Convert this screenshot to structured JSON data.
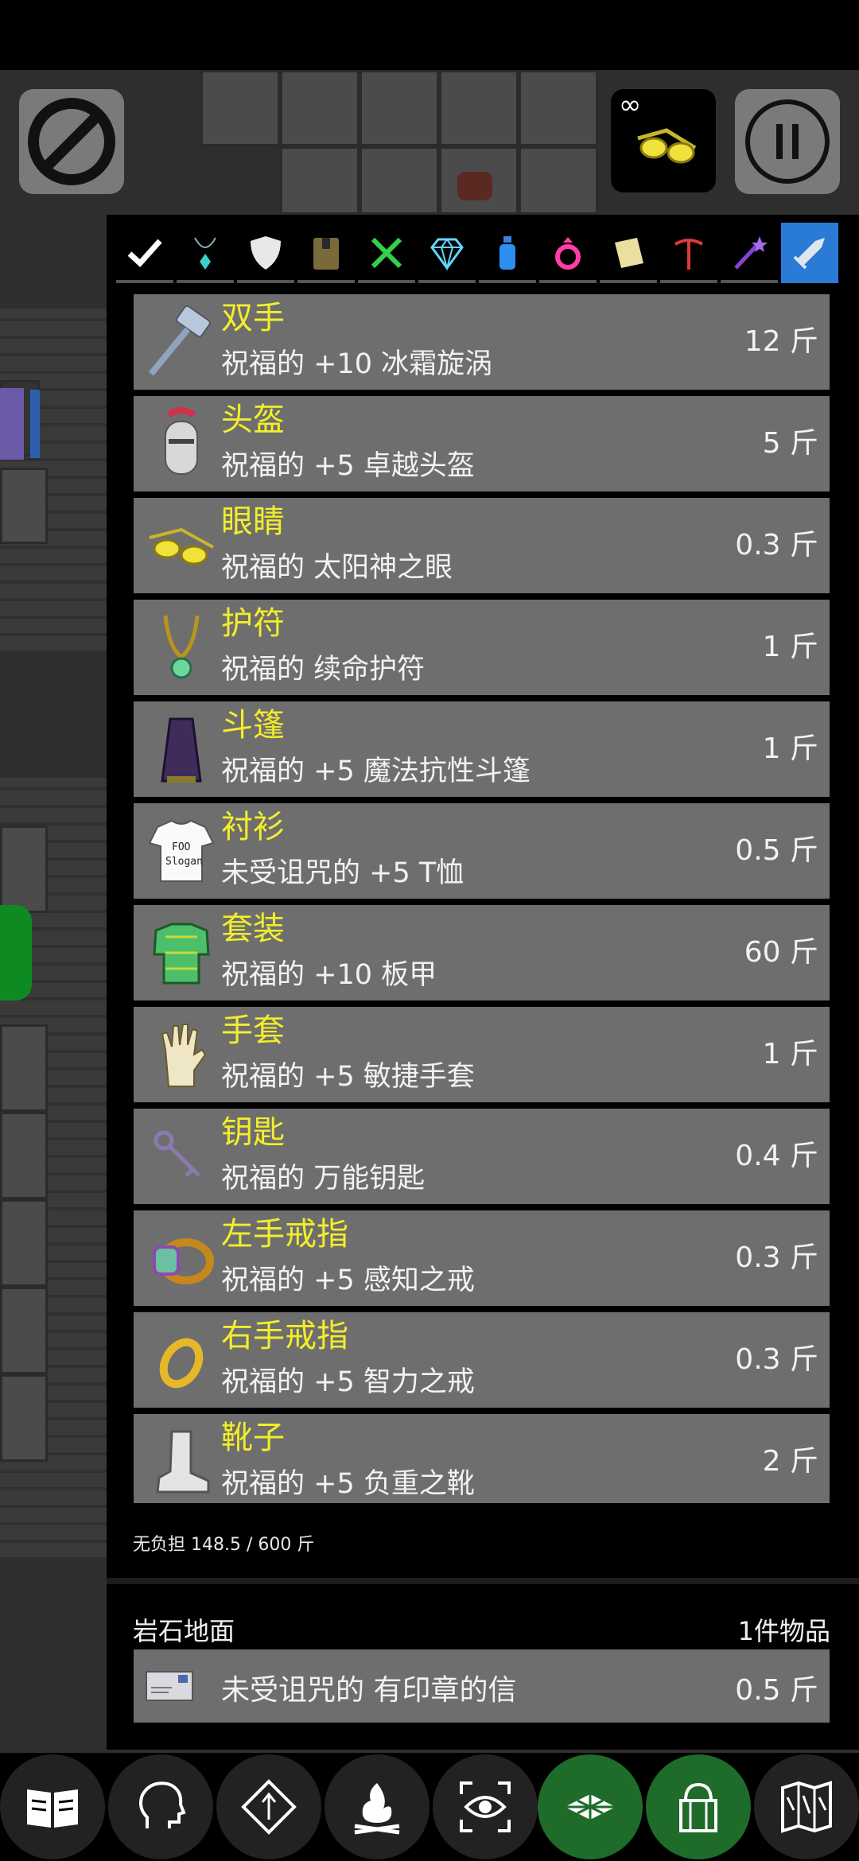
{
  "tabs": [
    {
      "name": "tab-all",
      "icon": "checkmark-icon",
      "active": false
    },
    {
      "name": "tab-amulet",
      "icon": "amulet-icon",
      "active": false
    },
    {
      "name": "tab-armor",
      "icon": "shield-icon",
      "active": false
    },
    {
      "name": "tab-books",
      "icon": "book-icon",
      "active": false
    },
    {
      "name": "tab-food",
      "icon": "fork-knife-icon",
      "active": false
    },
    {
      "name": "tab-gems",
      "icon": "gem-icon",
      "active": false
    },
    {
      "name": "tab-potions",
      "icon": "potion-icon",
      "active": false
    },
    {
      "name": "tab-rings",
      "icon": "ring-icon",
      "active": false
    },
    {
      "name": "tab-scrolls",
      "icon": "scroll-icon",
      "active": false
    },
    {
      "name": "tab-tools",
      "icon": "pickaxe-icon",
      "active": false
    },
    {
      "name": "tab-wands",
      "icon": "wand-icon",
      "active": false
    },
    {
      "name": "tab-weapons",
      "icon": "sword-icon",
      "active": true
    }
  ],
  "equipment": [
    {
      "slot": "双手",
      "desc": "祝福的 +10 冰霜旋涡",
      "weight": "12 斤",
      "icon": "hammer-icon"
    },
    {
      "slot": "头盔",
      "desc": "祝福的 +5 卓越头盔",
      "weight": "5 斤",
      "icon": "helmet-icon"
    },
    {
      "slot": "眼睛",
      "desc": "祝福的 太阳神之眼",
      "weight": "0.3 斤",
      "icon": "sunglasses-icon"
    },
    {
      "slot": "护符",
      "desc": "祝福的 续命护符",
      "weight": "1 斤",
      "icon": "amulet-icon"
    },
    {
      "slot": "斗篷",
      "desc": "祝福的 +5 魔法抗性斗篷",
      "weight": "1 斤",
      "icon": "cloak-icon"
    },
    {
      "slot": "衬衫",
      "desc": "未受诅咒的 +5 T恤",
      "weight": "0.5 斤",
      "icon": "tshirt-icon"
    },
    {
      "slot": "套装",
      "desc": "祝福的 +10 板甲",
      "weight": "60 斤",
      "icon": "plate-armor-icon"
    },
    {
      "slot": "手套",
      "desc": "祝福的 +5 敏捷手套",
      "weight": "1 斤",
      "icon": "glove-icon"
    },
    {
      "slot": "钥匙",
      "desc": "祝福的 万能钥匙",
      "weight": "0.4 斤",
      "icon": "key-icon"
    },
    {
      "slot": "左手戒指",
      "desc": "祝福的 +5 感知之戒",
      "weight": "0.3 斤",
      "icon": "gem-ring-icon"
    },
    {
      "slot": "右手戒指",
      "desc": "祝福的 +5 智力之戒",
      "weight": "0.3 斤",
      "icon": "gold-ring-icon"
    },
    {
      "slot": "靴子",
      "desc": "祝福的 +5 负重之靴",
      "weight": "2 斤",
      "icon": "boot-icon"
    }
  ],
  "tshirt_text": {
    "line1": "FOO",
    "line2": "Slogan"
  },
  "encumbrance": "无负担 148.5 / 600 斤",
  "floor": {
    "label": "岩石地面",
    "count": "1件物品",
    "item": {
      "desc": "未受诅咒的 有印章的信",
      "weight": "0.5 斤",
      "icon": "envelope-icon"
    }
  },
  "quick_item": {
    "badge": "∞",
    "icon": "sunglasses-icon"
  },
  "bottom_buttons": [
    {
      "name": "spellbook-button",
      "icon": "open-book-icon"
    },
    {
      "name": "character-button",
      "icon": "head-profile-icon"
    },
    {
      "name": "religion-button",
      "icon": "diamond-sign-icon"
    },
    {
      "name": "rest-button",
      "icon": "campfire-icon"
    },
    {
      "name": "look-button",
      "icon": "eye-icon"
    },
    {
      "name": "floor-button",
      "icon": "floor-tiles-icon"
    },
    {
      "name": "inventory-button",
      "icon": "gift-bag-icon"
    },
    {
      "name": "map-button",
      "icon": "map-icon"
    }
  ],
  "colors": {
    "slot_text": "#f3ee2a",
    "row_bg": "#6e6e6e",
    "active_tab": "#2a7bd6",
    "green_button": "#1e6b2a"
  }
}
